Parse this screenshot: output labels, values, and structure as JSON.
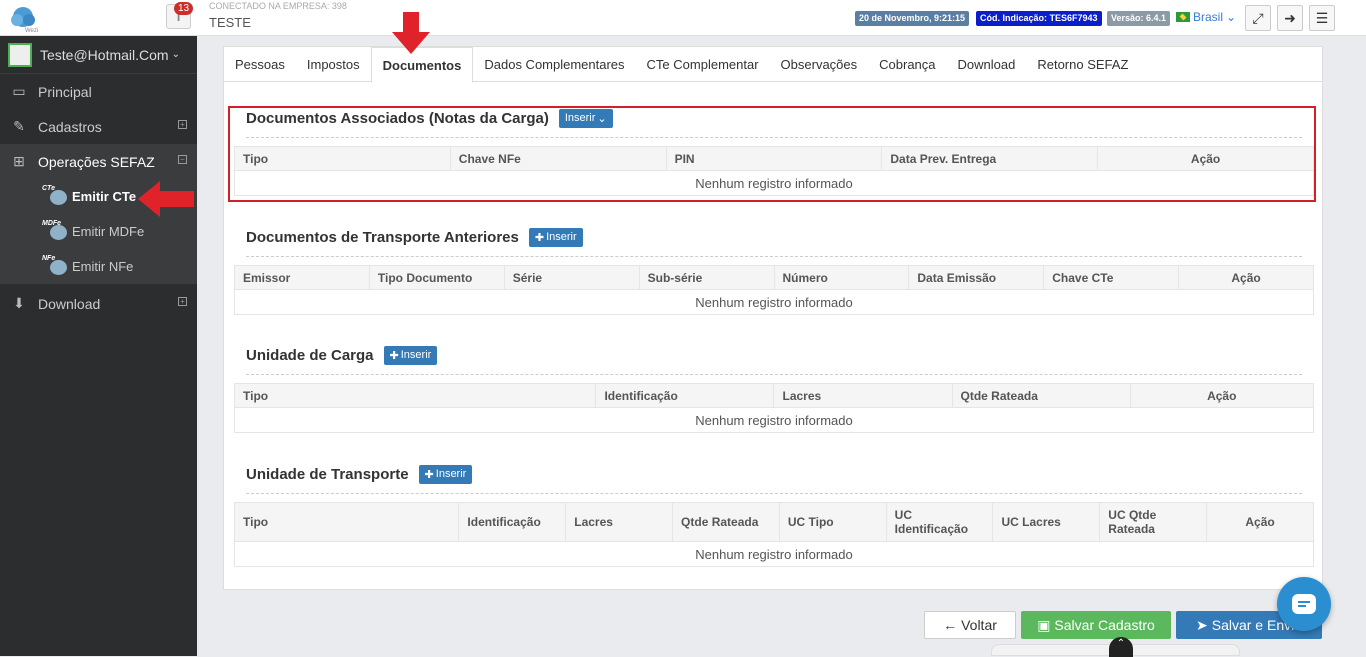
{
  "header": {
    "company_label": "CONECTADO NA EMPRESA: 398",
    "company_name": "TESTE",
    "notifications": "13",
    "date_badge": "20 de Novembro, 9:21:15",
    "code_badge": "Cód. Indicação: TES6F7943",
    "version_badge": "Versão: 6.4.1",
    "language": "Brasil",
    "colors": {
      "date": "#5b7fa3",
      "code": "#0a1ec9",
      "version": "#8c9aa6"
    }
  },
  "sidebar": {
    "user": "Teste@Hotmail.Com",
    "items": [
      {
        "label": "Principal",
        "icon": "laptop-icon"
      },
      {
        "label": "Cadastros",
        "icon": "edit-icon"
      },
      {
        "label": "Operações SEFAZ",
        "icon": "windows-icon"
      }
    ],
    "sub_items": [
      {
        "label": "Emitir CTe",
        "tag": "CTe"
      },
      {
        "label": "Emitir MDFe",
        "tag": "MDFe"
      },
      {
        "label": "Emitir NFe",
        "tag": "NFe"
      }
    ],
    "download": "Download"
  },
  "tabs": [
    "Pessoas",
    "Impostos",
    "Documentos",
    "Dados Complementares",
    "CTe Complementar",
    "Observações",
    "Cobrança",
    "Download",
    "Retorno SEFAZ"
  ],
  "sections": {
    "docs": {
      "title": "Documentos Associados (Notas da Carga)",
      "button": "Inserir",
      "columns": [
        "Tipo",
        "Chave NFe",
        "PIN",
        "Data Prev. Entrega",
        "Ação"
      ]
    },
    "transport": {
      "title": "Documentos de Transporte Anteriores",
      "button": "Inserir",
      "columns": [
        "Emissor",
        "Tipo Documento",
        "Série",
        "Sub-série",
        "Número",
        "Data Emissão",
        "Chave CTe",
        "Ação"
      ]
    },
    "cargo": {
      "title": "Unidade de Carga",
      "button": "Inserir",
      "columns": [
        "Tipo",
        "Identificação",
        "Lacres",
        "Qtde Rateada",
        "Ação"
      ]
    },
    "unit": {
      "title": "Unidade de Transporte",
      "button": "Inserir",
      "columns": [
        "Tipo",
        "Identificação",
        "Lacres",
        "Qtde Rateada",
        "UC Tipo",
        "UC Identificação",
        "UC Lacres",
        "UC Qtde Rateada",
        "Ação"
      ]
    },
    "empty": "Nenhum registro informado"
  },
  "footer": {
    "back": "Voltar",
    "save": "Salvar Cadastro",
    "send": "Salvar e Enviar"
  }
}
